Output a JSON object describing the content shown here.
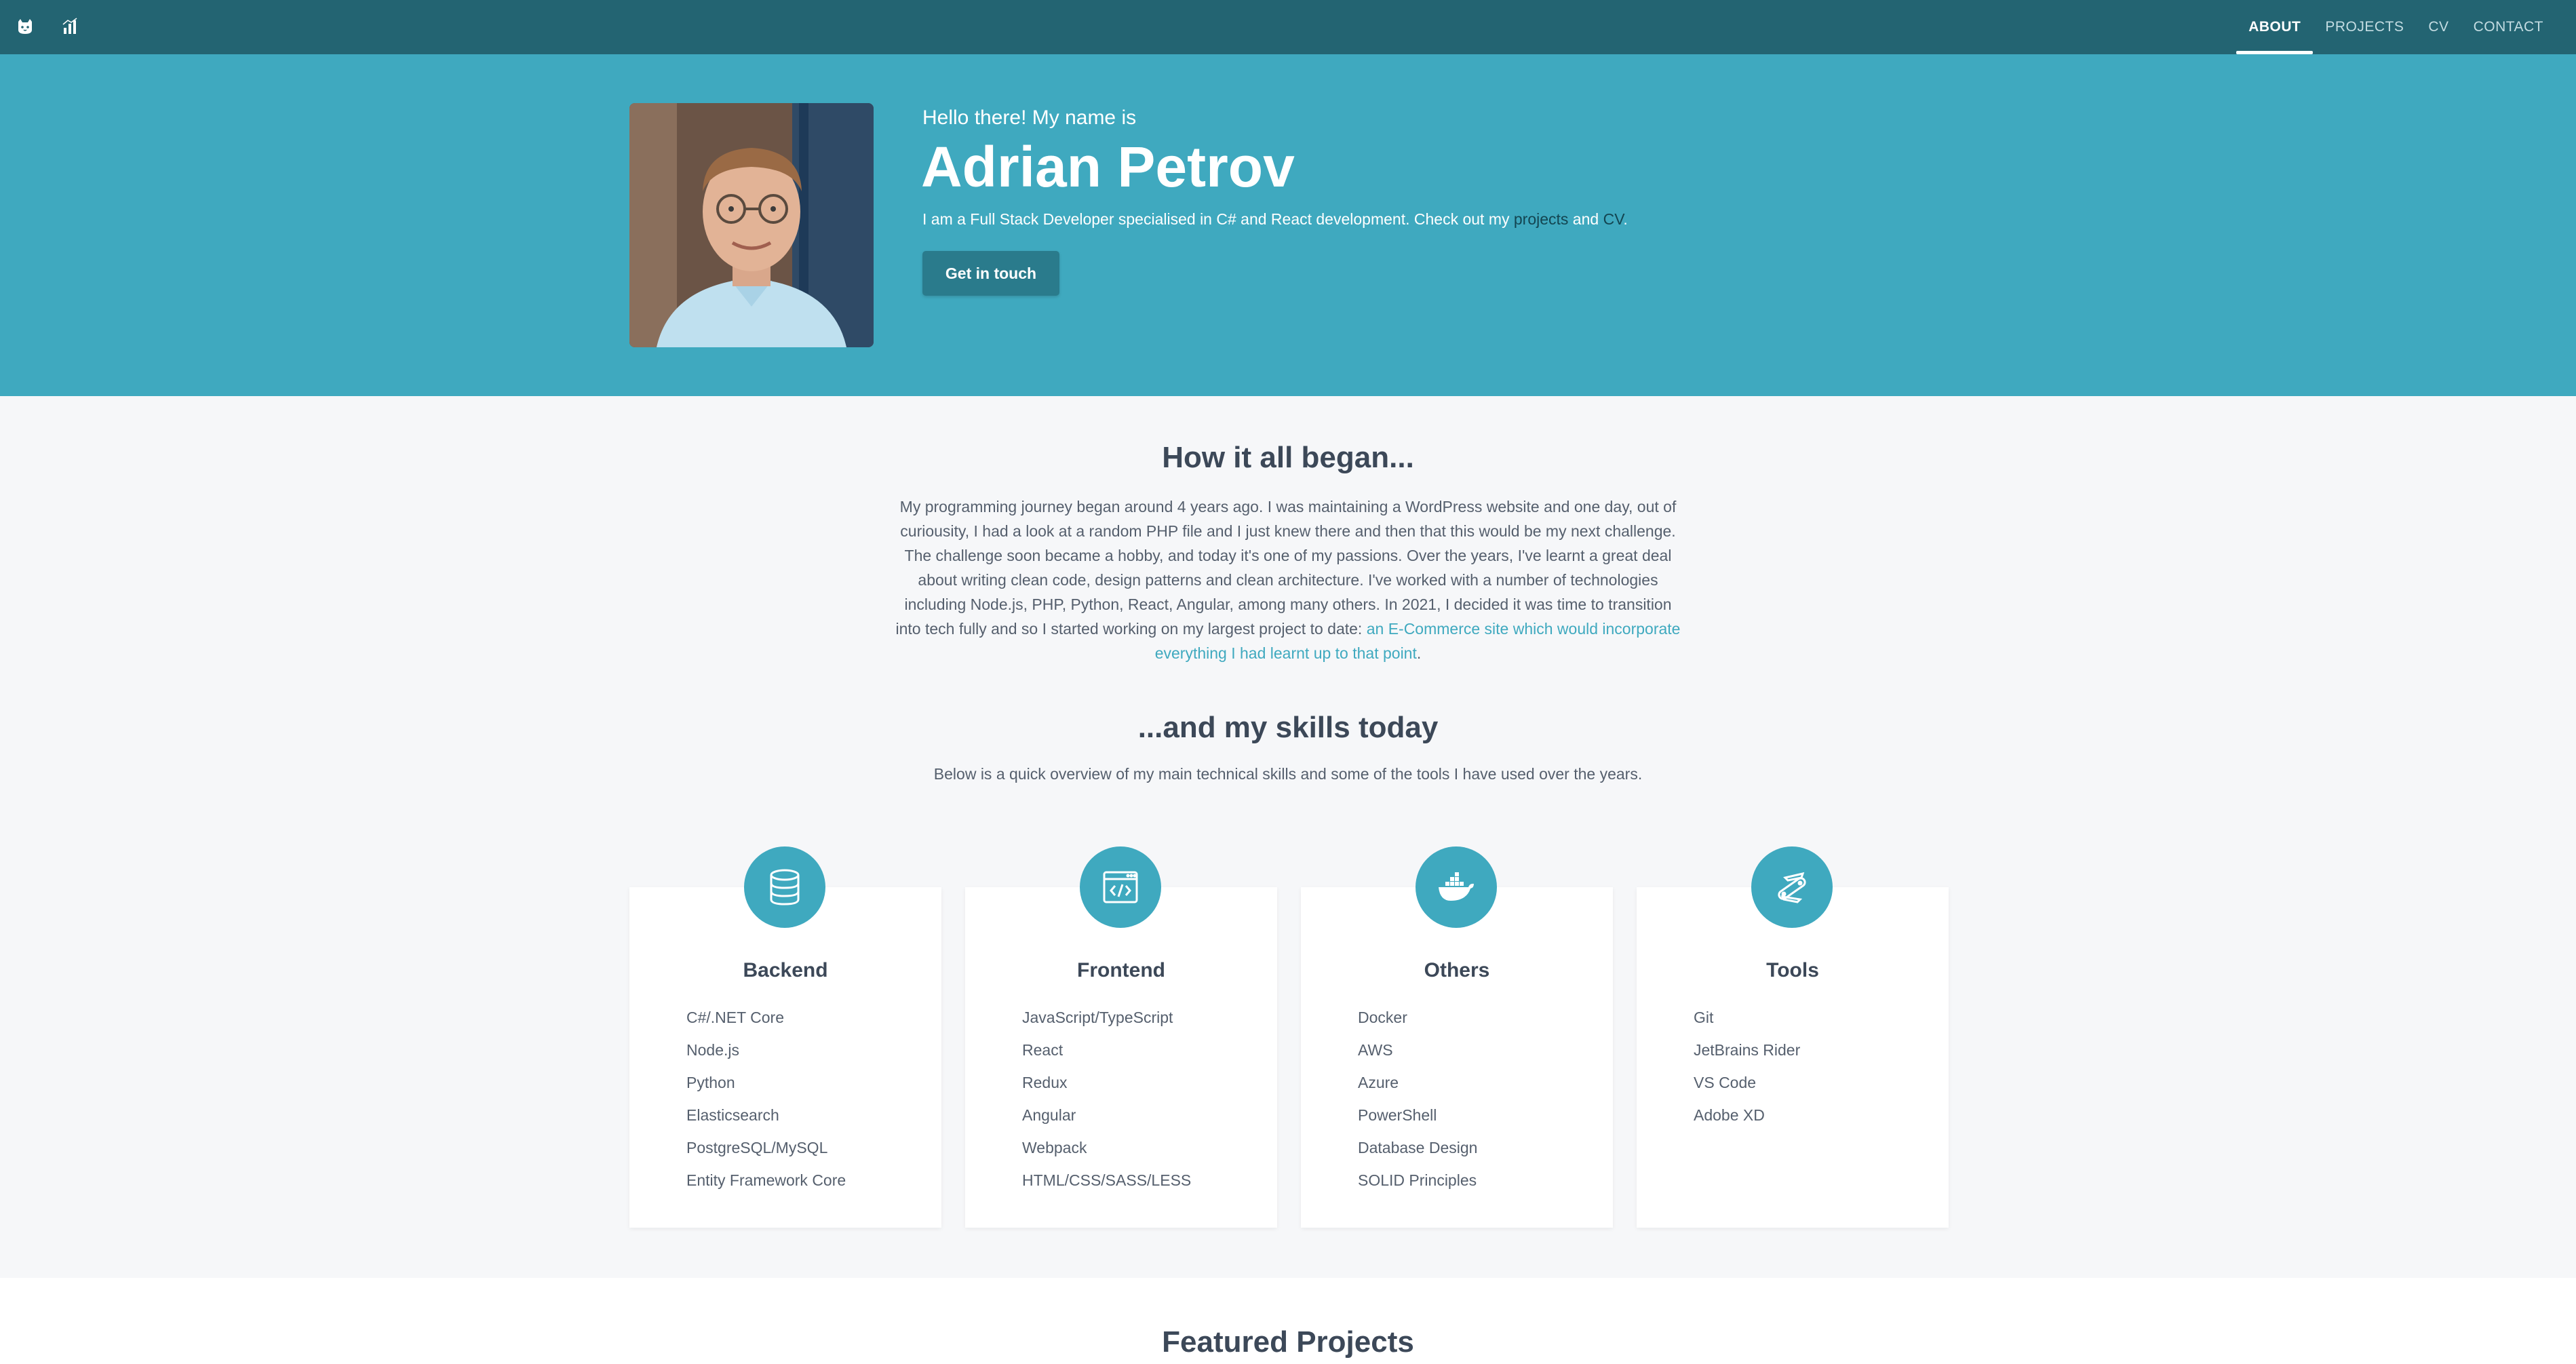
{
  "navbar": {
    "logo_icon": "cat-face-icon",
    "chart_icon": "bar-chart-icon",
    "links": [
      {
        "label": "ABOUT",
        "active": true
      },
      {
        "label": "PROJECTS",
        "active": false
      },
      {
        "label": "CV",
        "active": false
      },
      {
        "label": "CONTACT",
        "active": false
      }
    ]
  },
  "hero": {
    "greeting": "Hello there! My name is",
    "name": "Adrian Petrov",
    "description_before": "I am a Full Stack Developer specialised in C# and React development. Check out my ",
    "projects_link": "projects",
    "description_and": " and ",
    "cv_link": "CV",
    "description_end": ".",
    "button_label": "Get in touch"
  },
  "about": {
    "title": "How it all began...",
    "text": "My programming journey began around 4 years ago. I was maintaining a WordPress website and one day, out of curiousity, I had a look at a random PHP file and I just knew there and then that this would be my next challenge. The challenge soon became a hobby, and today it's one of my passions. Over the years, I've learnt a great deal about writing clean code, design patterns and clean architecture. I've worked with a number of technologies including Node.js, PHP, Python, React, Angular, among many others. In 2021, I decided it was time to transition into tech fully and so I started working on my largest project to date: ",
    "link_text": "an E-Commerce site which would incorporate everything I had learnt up to that point",
    "text_end": "."
  },
  "skills": {
    "title": "...and my skills today",
    "subtitle": "Below is a quick overview of my main technical skills and some of the tools I have used over the years.",
    "cards": [
      {
        "title": "Backend",
        "icon": "database-icon",
        "items": [
          "C#/.NET Core",
          "Node.js",
          "Python",
          "Elasticsearch",
          "PostgreSQL/MySQL",
          "Entity Framework Core"
        ]
      },
      {
        "title": "Frontend",
        "icon": "browser-code-icon",
        "items": [
          "JavaScript/TypeScript",
          "React",
          "Redux",
          "Angular",
          "Webpack",
          "HTML/CSS/SASS/LESS"
        ]
      },
      {
        "title": "Others",
        "icon": "docker-whale-icon",
        "items": [
          "Docker",
          "AWS",
          "Azure",
          "PowerShell",
          "Database Design",
          "SOLID Principles"
        ]
      },
      {
        "title": "Tools",
        "icon": "pocket-knife-icon",
        "items": [
          "Git",
          "JetBrains Rider",
          "VS Code",
          "Adobe XD"
        ]
      }
    ]
  },
  "featured": {
    "title": "Featured Projects"
  },
  "colors": {
    "navbar": "#236472",
    "hero": "#3fa9bf",
    "button": "#2a7b8c",
    "accent": "#3fa9bf",
    "background": "#f6f7f9"
  }
}
